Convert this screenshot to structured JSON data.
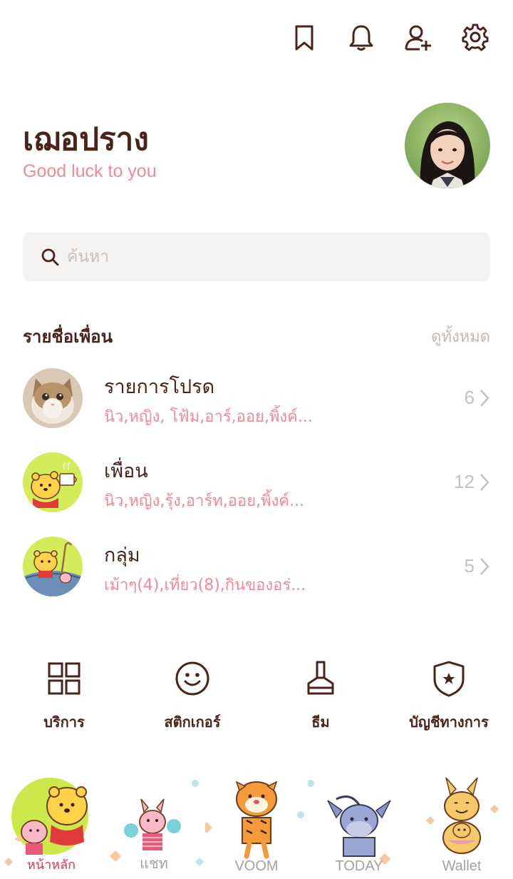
{
  "header": {
    "icons": [
      "bookmark-icon",
      "bell-icon",
      "add-friend-icon",
      "settings-icon"
    ]
  },
  "profile": {
    "name": "เฌอปราง",
    "status_message": "Good luck to you"
  },
  "search": {
    "placeholder": "ค้นหา"
  },
  "friends_section": {
    "title": "รายชื่อเพื่อน",
    "see_all": "ดูทั้งหมด",
    "items": [
      {
        "title": "รายการโปรด",
        "subtitle": "นิว,หญิง, โฟ้ม,อาร์,ออย,พิ้งค์...",
        "count": "6"
      },
      {
        "title": "เพื่อน",
        "subtitle": "นิว,หญิง,รุ้ง,อาร์ท,ออย,พิ้งค์...",
        "count": "12"
      },
      {
        "title": "กลุ่ม",
        "subtitle": "เม้าๆ(4),เที่ยว(8),กินของอร่...",
        "count": "5"
      }
    ]
  },
  "services": [
    {
      "label": "บริการ",
      "icon": "grid-icon"
    },
    {
      "label": "สติกเกอร์",
      "icon": "smiley-icon"
    },
    {
      "label": "ธีม",
      "icon": "paint-brush-icon"
    },
    {
      "label": "บัญชีทางการ",
      "icon": "shield-star-icon"
    }
  ],
  "tabbar": {
    "tabs": [
      {
        "label": "หน้าหลัก",
        "active": true
      },
      {
        "label": "แชท",
        "active": false
      },
      {
        "label": "VOOM",
        "active": false
      },
      {
        "label": "TODAY",
        "active": false
      },
      {
        "label": "Wallet",
        "active": false
      }
    ]
  },
  "colors": {
    "text_brown": "#4a2418",
    "accent_pink": "#f08a98",
    "active_tab": "#e8334a",
    "muted": "#c8c0bc"
  }
}
